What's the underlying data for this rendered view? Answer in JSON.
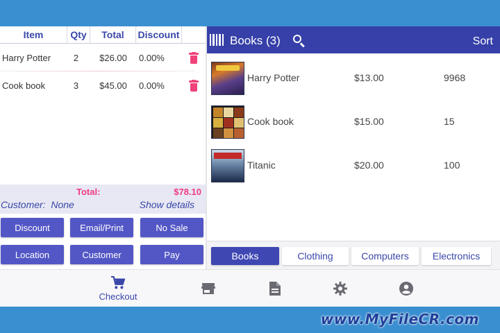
{
  "cart": {
    "headers": {
      "item": "Item",
      "qty": "Qty",
      "total": "Total",
      "discount": "Discount"
    },
    "rows": [
      {
        "item": "Harry Potter",
        "qty": "2",
        "total": "$26.00",
        "discount": "0.00%"
      },
      {
        "item": "Cook book",
        "qty": "3",
        "total": "$45.00",
        "discount": "0.00%"
      }
    ],
    "total_label": "Total:",
    "total_value": "$78.10",
    "customer_label": "Customer:",
    "customer_value": "None",
    "show_details": "Show details"
  },
  "actions": {
    "discount": "Discount",
    "email_print": "Email/Print",
    "no_sale": "No Sale",
    "location": "Location",
    "customer": "Customer",
    "pay": "Pay"
  },
  "catalog": {
    "title": "Books (3)",
    "sort": "Sort",
    "products": [
      {
        "name": "Harry Potter",
        "price": "$13.00",
        "stock": "9968"
      },
      {
        "name": "Cook book",
        "price": "$15.00",
        "stock": "15"
      },
      {
        "name": "Titanic",
        "price": "$20.00",
        "stock": "100"
      }
    ],
    "categories": [
      "Books",
      "Clothing",
      "Computers",
      "Electronics"
    ]
  },
  "nav": {
    "checkout": "Checkout"
  },
  "watermark": "www.MyFileCR.com",
  "colors": {
    "primary": "#3640a8",
    "button": "#5357c6",
    "accent": "#f0437a",
    "top_bar": "#3a8fd0"
  },
  "icons": [
    "barcode-icon",
    "search-icon",
    "trash-icon",
    "cart-icon",
    "store-icon",
    "document-icon",
    "gear-icon",
    "account-icon"
  ]
}
